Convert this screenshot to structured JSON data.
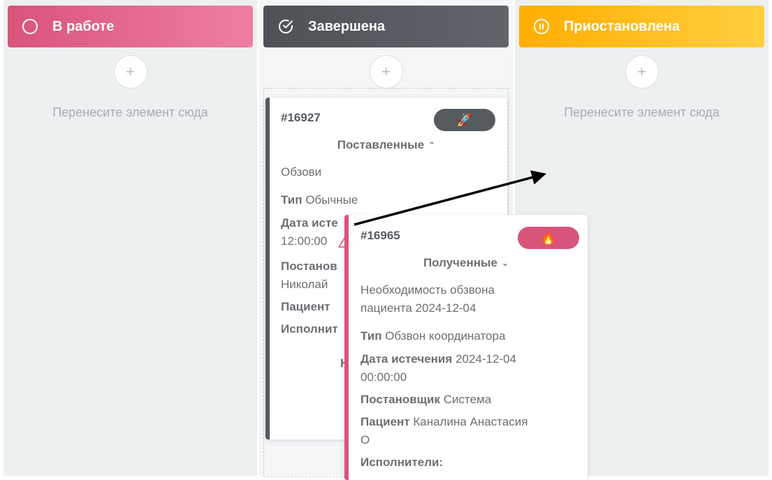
{
  "columns": [
    {
      "title": "В работе",
      "icon": "circle-icon",
      "color": "#d9547a",
      "empty_hint": "Перенесите элемент сюда"
    },
    {
      "title": "Завершена",
      "icon": "check-circle-icon",
      "color": "#4e5257"
    },
    {
      "title": "Приостановлена",
      "icon": "pause-circle-icon",
      "color": "#ffae00",
      "empty_hint": "Перенесите элемент сюда"
    }
  ],
  "add_label": "+",
  "cards": [
    {
      "number": "#16927",
      "badge_icon": "rocket-icon",
      "badge_glyph": "🚀",
      "badge_color": "#555a5f",
      "stage": "Поставленные",
      "stage_chevron": "⌃",
      "description": "Обзови",
      "type_label": "Тип",
      "type_value": "Обычные",
      "due_label": "Дата исте",
      "due_time": "12:00:00",
      "creator_label": "Постанов",
      "creator_value": "Николай",
      "patient_label": "Пациент",
      "executors_label": "Исполнит",
      "truncated": "Н"
    },
    {
      "number": "#16965",
      "badge_icon": "fire-icon",
      "badge_glyph": "🔥",
      "badge_color": "#d9547a",
      "stage": "Полученные",
      "stage_chevron": "⌄",
      "description_line1": "Необходимость обзвона",
      "description_line2": "пациента 2024-12-04",
      "type_label": "Тип",
      "type_value": "Обзвон координатора",
      "due_label": "Дата истечения",
      "due_value": "2024-12-04",
      "due_time": "00:00:00",
      "creator_label": "Постановщик",
      "creator_value": "Система",
      "patient_label": "Пациент",
      "patient_value": "Каналина Анастасия",
      "patient_value2": "О",
      "executors_label": "Исполнители:"
    }
  ]
}
